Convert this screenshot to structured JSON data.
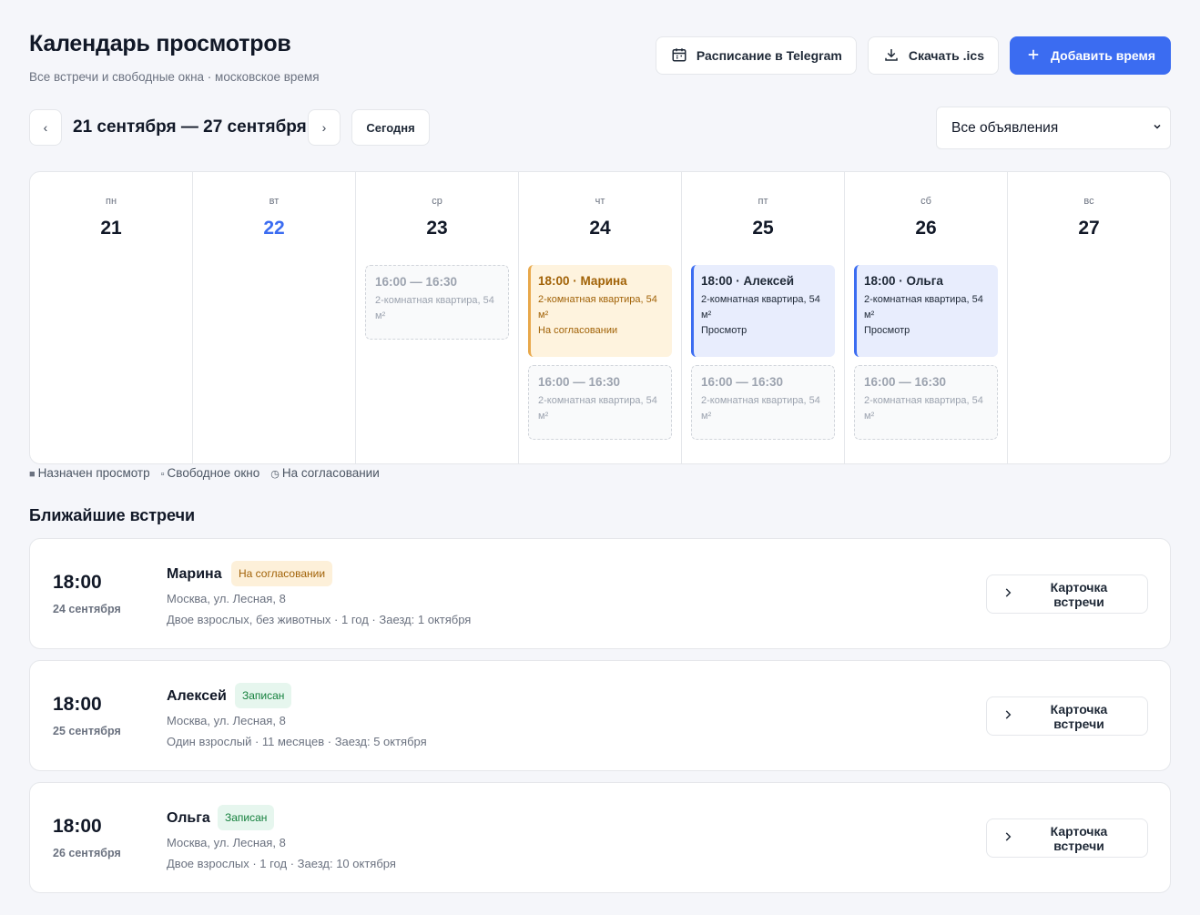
{
  "header": {
    "title": "Календарь просмотров",
    "subtitle": "Все встречи и свободные окна · московское время"
  },
  "actions": {
    "telegram_label": "Расписание в Telegram",
    "ics_label": "Скачать .ics",
    "add_label": "Добавить время"
  },
  "toolbar": {
    "prev": "‹",
    "next": "›",
    "range": "21 сентября — 27 сентября",
    "today_label": "Сегодня",
    "filter_value": "Все объявления"
  },
  "calendar": {
    "days": [
      {
        "dow": "пн",
        "num": "21"
      },
      {
        "dow": "вт",
        "num": "22",
        "today": true
      },
      {
        "dow": "ср",
        "num": "23"
      },
      {
        "dow": "чт",
        "num": "24"
      },
      {
        "dow": "пт",
        "num": "25"
      },
      {
        "dow": "сб",
        "num": "26"
      },
      {
        "dow": "вс",
        "num": "27"
      }
    ],
    "events": {
      "wed_free": {
        "title": "16:00 — 16:30",
        "desc": "2-комнатная квартира, 54 м²"
      },
      "thu_pending": {
        "title": "18:00 · Марина",
        "desc": "2-комнатная квартира, 54 м²",
        "status": "На согласовании"
      },
      "thu_free": {
        "title": "16:00 — 16:30",
        "desc": "2-комнатная квартира, 54 м²"
      },
      "fri_booked": {
        "title": "18:00 · Алексей",
        "desc": "2-комнатная квартира, 54 м²",
        "status": "Просмотр"
      },
      "fri_free": {
        "title": "16:00 — 16:30",
        "desc": "2-комнатная квартира, 54 м²"
      },
      "sat_booked": {
        "title": "18:00 · Ольга",
        "desc": "2-комнатная квартира, 54 м²",
        "status": "Просмотр"
      },
      "sat_free": {
        "title": "16:00 — 16:30",
        "desc": "2-комнатная квартира, 54 м²"
      }
    }
  },
  "legend": {
    "booked_icon": "■",
    "booked": "Назначен просмотр",
    "free_icon": "▫",
    "free": "Свободное окно",
    "pending_icon": "◷",
    "pending": "На согласовании"
  },
  "upcoming": {
    "title": "Ближайшие встречи",
    "card_label": "Карточка встречи",
    "items": [
      {
        "time": "18:00",
        "date": "24 сентября",
        "name": "Марина",
        "badge": "На согласовании",
        "address": "Москва, ул. Лесная, 8",
        "meta": "Двое взрослых, без животных · 1 год · Заезд: 1 октября"
      },
      {
        "time": "18:00",
        "date": "25 сентября",
        "name": "Алексей",
        "badge": "Записан",
        "address": "Москва, ул. Лесная, 8",
        "meta": "Один взрослый · 11 месяцев · Заезд: 5 октября"
      },
      {
        "time": "18:00",
        "date": "26 сентября",
        "name": "Ольга",
        "badge": "Записан",
        "address": "Москва, ул. Лесная, 8",
        "meta": "Двое взрослых · 1 год · Заезд: 10 октября"
      }
    ]
  },
  "colors": {
    "accent": "#3b6cf1",
    "pending_bg": "#fef3de",
    "pending_border": "#e8a84a",
    "booked_bg": "#e8edfd",
    "success_bg": "#e6f6ee",
    "success_text": "#15803d"
  }
}
